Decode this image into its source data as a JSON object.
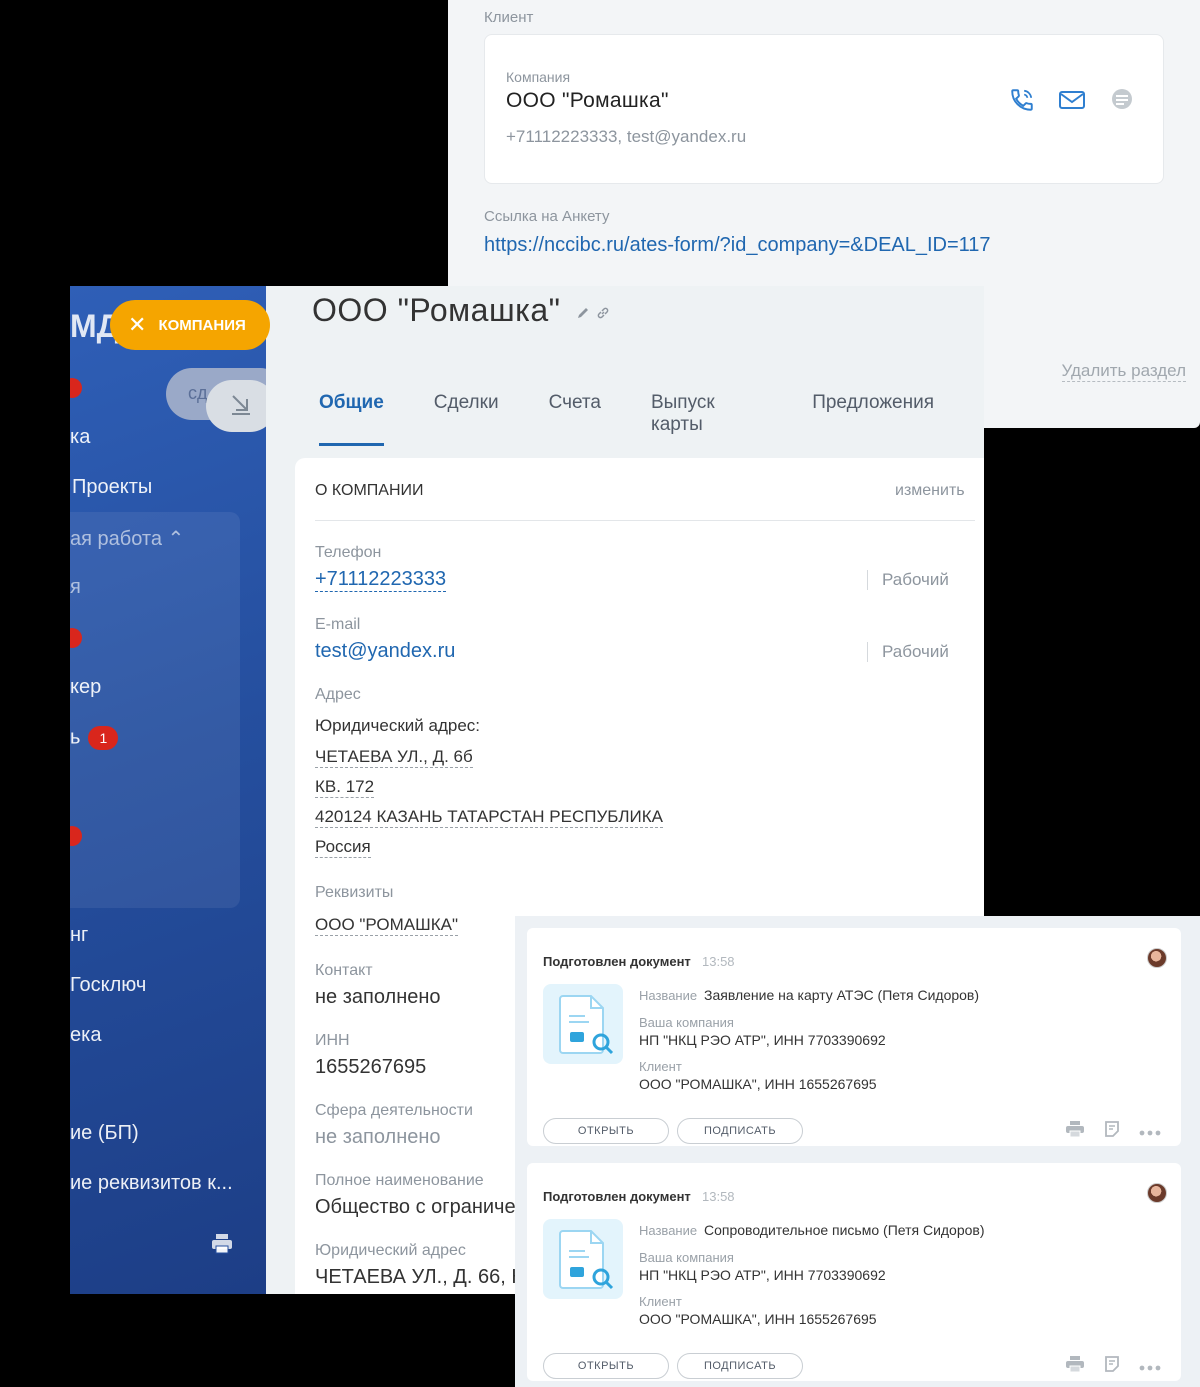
{
  "client_panel": {
    "section_title": "Клиент",
    "company_label": "Компания",
    "company_name": "ООО \"Ромашка\"",
    "contacts": "+71112223333, test@yandex.ru",
    "icons": [
      "phone-icon",
      "mail-icon",
      "chat-icon"
    ],
    "anketa_label": "Ссылка на Анкету",
    "anketa_link": "https://nccibc.ru/ates-form/?id_company=&DEAL_ID=117",
    "delete_section": "Удалить раздел"
  },
  "sidebar": {
    "brand": "МД",
    "chip_label": "КОМПАНИЯ",
    "pill_label": "сд",
    "items": {
      "i1": "ка",
      "i2": "Проекты",
      "i3": "ая работа",
      "i4": "я",
      "i5": "кер",
      "i6": "ь",
      "i6_badge": "1",
      "i7": "нг",
      "i8": "Госключ",
      "i9": "ека",
      "i10": "ие (БП)",
      "i11": "ие реквизитов к..."
    }
  },
  "content": {
    "title": "ООО \"Ромашка\"",
    "tabs": [
      "Общие",
      "Сделки",
      "Счета",
      "Выпуск карты",
      "Предложения"
    ],
    "card_title": "О КОМПАНИИ",
    "edit_label": "изменить",
    "phone_label": "Телефон",
    "phone": "+71112223333",
    "phone_type": "Рабочий",
    "email_label": "E-mail",
    "email": "test@yandex.ru",
    "email_type": "Рабочий",
    "address_label": "Адрес",
    "legal_address_head": "Юридический адрес:",
    "address_lines": [
      "ЧЕТАЕВА УЛ., Д. 6б",
      "КВ. 172",
      "420124 КАЗАНЬ ТАТАРСТАН РЕСПУБЛИКА",
      "Россия"
    ],
    "requisites_label": "Реквизиты",
    "requisites": "ООО \"РОМАШКА\"",
    "contact_label": "Контакт",
    "contact": "не заполнено",
    "inn_label": "ИНН",
    "inn": "1655267695",
    "sphere_label": "Сфера деятельности",
    "sphere": "не заполнено",
    "full_name_label": "Полное наименование",
    "full_name": "Общество с ограниче",
    "legal_address_label": "Юридический адрес",
    "legal_address": "ЧЕТАЕВА УЛ., Д. 66, К"
  },
  "timeline": {
    "cards": [
      {
        "event": "Подготовлен документ",
        "time": "13:58",
        "name_label": "Название",
        "name": "Заявление на карту АТЭС (Петя Сидоров)",
        "company_label": "Ваша компания",
        "company": "НП \"НКЦ РЭО АТР\", ИНН 7703390692",
        "client_label": "Клиент",
        "client": "ООО \"РОМАШКА\", ИНН 1655267695",
        "open": "ОТКРЫТЬ",
        "sign": "ПОДПИСАТЬ"
      },
      {
        "event": "Подготовлен документ",
        "time": "13:58",
        "name_label": "Название",
        "name": "Сопроводительное письмо (Петя Сидоров)",
        "company_label": "Ваша компания",
        "company": "НП \"НКЦ РЭО АТР\", ИНН 7703390692",
        "client_label": "Клиент",
        "client": "ООО \"РОМАШКА\", ИНН 1655267695",
        "open": "ОТКРЫТЬ",
        "sign": "ПОДПИСАТЬ"
      }
    ]
  },
  "colors": {
    "accent_blue": "#2067b0",
    "sidebar_blue": "#254f9f",
    "chip_orange": "#f5a500",
    "badge_red": "#d9261c"
  }
}
